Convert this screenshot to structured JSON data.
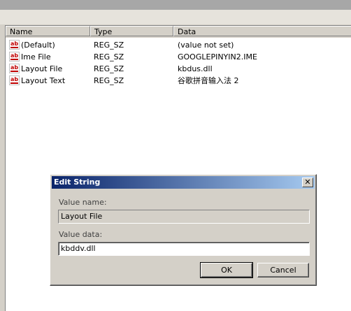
{
  "listview": {
    "columns": {
      "name": "Name",
      "type": "Type",
      "data": "Data"
    },
    "rows": [
      {
        "icon": "string-value-icon",
        "name": "(Default)",
        "type": "REG_SZ",
        "data": "(value not set)"
      },
      {
        "icon": "string-value-icon",
        "name": "Ime File",
        "type": "REG_SZ",
        "data": "GOOGLEPINYIN2.IME"
      },
      {
        "icon": "string-value-icon",
        "name": "Layout File",
        "type": "REG_SZ",
        "data": "kbdus.dll"
      },
      {
        "icon": "string-value-icon",
        "name": "Layout Text",
        "type": "REG_SZ",
        "data": "谷歌拼音输入法 2"
      }
    ],
    "icon_glyph": "ab"
  },
  "dialog": {
    "title": "Edit String",
    "close_glyph": "✕",
    "value_name_label": "Value name:",
    "value_name": "Layout File",
    "value_data_label": "Value data:",
    "value_data": "kbddv.dll",
    "ok_label": "OK",
    "cancel_label": "Cancel"
  },
  "colors": {
    "title_gradient_start": "#0a246a",
    "title_gradient_end": "#a6caf0",
    "window_face": "#d4d0c8"
  }
}
